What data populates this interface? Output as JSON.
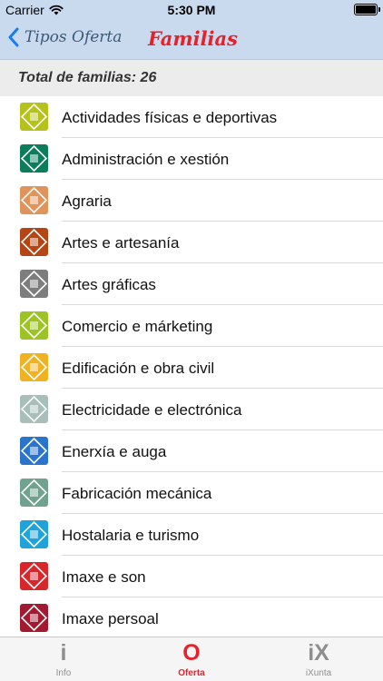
{
  "status_bar": {
    "carrier": "Carrier",
    "time": "5:30 PM",
    "battery_level": 1.0
  },
  "nav": {
    "back_label": "Tipos Oferta",
    "title": "Familias"
  },
  "header": {
    "total_label": "Total de familias: 26"
  },
  "families": [
    {
      "label": "Actividades físicas e deportivas",
      "icon": "sports-icon",
      "color": "#b5c21b"
    },
    {
      "label": "Administración e xestión",
      "icon": "administration-icon",
      "color": "#0b7d5a"
    },
    {
      "label": "Agraria",
      "icon": "agriculture-icon",
      "color": "#e0935a"
    },
    {
      "label": "Artes e artesanía",
      "icon": "arts-icon",
      "color": "#b54514"
    },
    {
      "label": "Artes gráficas",
      "icon": "graphic-arts-icon",
      "color": "#7d7d7d"
    },
    {
      "label": "Comercio e márketing",
      "icon": "commerce-icon",
      "color": "#9bc424"
    },
    {
      "label": "Edificación e obra civil",
      "icon": "building-icon",
      "color": "#f0b221"
    },
    {
      "label": "Electricidade e electrónica",
      "icon": "electricity-icon",
      "color": "#a7bfb8"
    },
    {
      "label": "Enerxía e auga",
      "icon": "energy-icon",
      "color": "#2a74cb"
    },
    {
      "label": "Fabricación mecánica",
      "icon": "mechanics-icon",
      "color": "#6fa38f"
    },
    {
      "label": "Hostalaria e turismo",
      "icon": "hospitality-icon",
      "color": "#1fa3d8"
    },
    {
      "label": "Imaxe e son",
      "icon": "image-sound-icon",
      "color": "#d8262b"
    },
    {
      "label": "Imaxe persoal",
      "icon": "personal-image-icon",
      "color": "#a31a30"
    }
  ],
  "tabs": {
    "info": {
      "glyph": "i",
      "label": "Info"
    },
    "oferta": {
      "glyph": "O",
      "label": "Oferta"
    },
    "ixunta": {
      "glyph": "iX",
      "label": "iXunta"
    }
  },
  "colors": {
    "nav_background": "#c9daee",
    "accent": "#e8202a",
    "back_tint": "#1a7cf5"
  }
}
